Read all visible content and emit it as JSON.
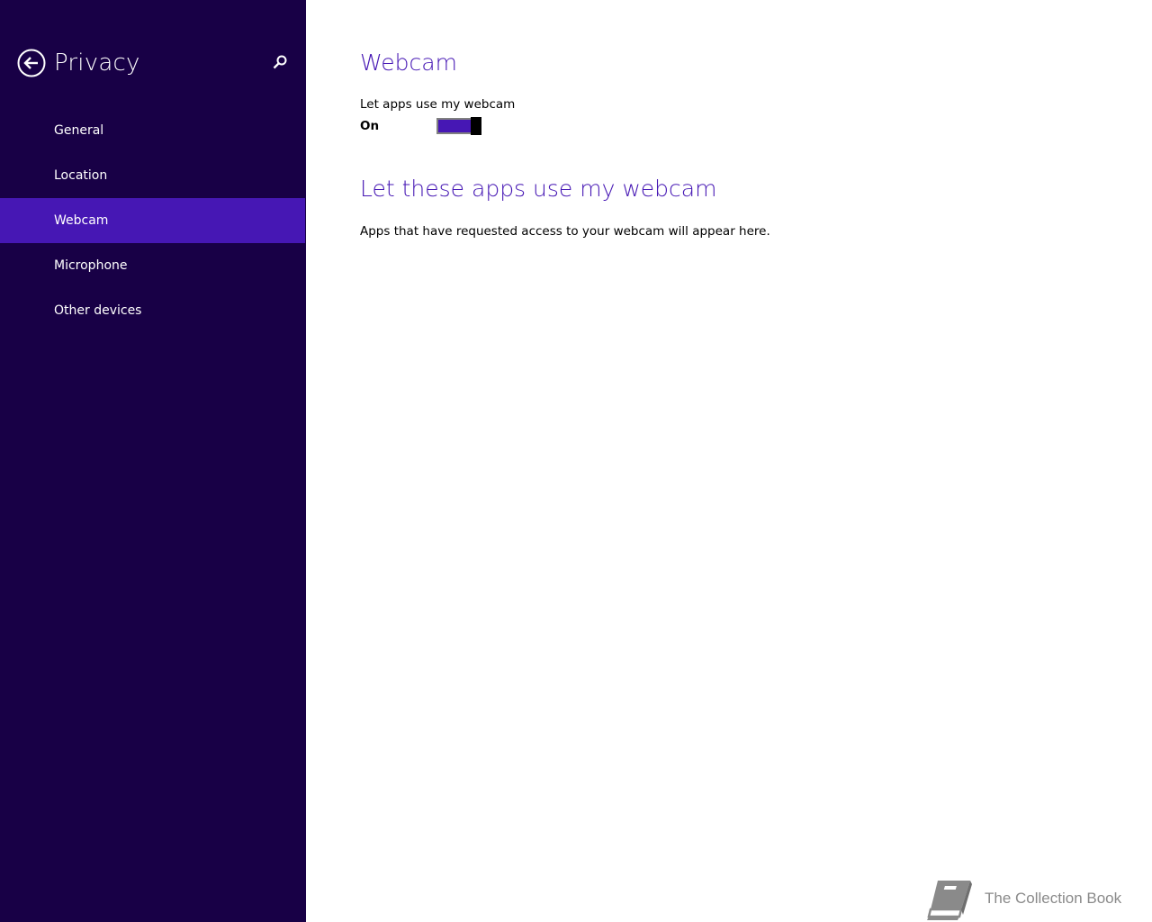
{
  "sidebar": {
    "title": "Privacy",
    "back_icon": "back-arrow-icon",
    "search_icon": "search-icon",
    "items": [
      {
        "label": "General",
        "selected": false
      },
      {
        "label": "Location",
        "selected": false
      },
      {
        "label": "Webcam",
        "selected": true
      },
      {
        "label": "Microphone",
        "selected": false
      },
      {
        "label": "Other devices",
        "selected": false
      }
    ]
  },
  "main": {
    "title": "Webcam",
    "setting_label": "Let apps use my webcam",
    "toggle_state": "On",
    "toggle_on": true,
    "apps_title": "Let these apps use my webcam",
    "apps_description": "Apps that have requested access to your webcam will appear here."
  },
  "watermark": {
    "text": "The Collection Book",
    "icon": "book-icon"
  },
  "colors": {
    "sidebar_bg": "#180046",
    "accent": "#4617b4",
    "text": "#000000",
    "watermark": "#8a8a8a"
  }
}
